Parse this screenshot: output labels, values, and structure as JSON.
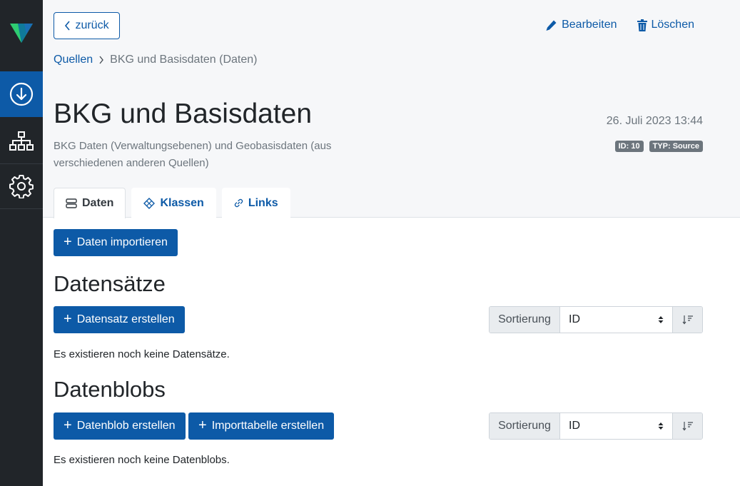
{
  "sidebar": {
    "logo": "app-logo",
    "items": [
      {
        "icon": "download-circle-icon",
        "active": true
      },
      {
        "icon": "sitemap-icon",
        "active": false
      },
      {
        "icon": "gear-icon",
        "active": false
      }
    ]
  },
  "header": {
    "back_label": "zurück",
    "edit_label": "Bearbeiten",
    "delete_label": "Löschen",
    "breadcrumb": {
      "root": "Quellen",
      "current": "BKG und Basisdaten (Daten)"
    },
    "title": "BKG und Basisdaten",
    "description": "BKG Daten (Verwaltungsebenen) und Geobasisdaten (aus verschiedenen anderen Quellen)",
    "date": "26. Juli 2023 13:44",
    "badges": {
      "id": "ID: 10",
      "type": "TYP: Source"
    },
    "tabs": [
      {
        "label": "Daten",
        "icon": "server-icon",
        "active": true
      },
      {
        "label": "Klassen",
        "icon": "diamond-icon",
        "active": false
      },
      {
        "label": "Links",
        "icon": "link-icon",
        "active": false
      }
    ]
  },
  "main": {
    "import_label": "Daten importieren",
    "datasets": {
      "title": "Datensätze",
      "create_label": "Datensatz erstellen",
      "sort_label": "Sortierung",
      "sort_value": "ID",
      "empty": "Es existieren noch keine Datensätze."
    },
    "blobs": {
      "title": "Datenblobs",
      "create_label": "Datenblob erstellen",
      "create_table_label": "Importtabelle erstellen",
      "sort_label": "Sortierung",
      "sort_value": "ID",
      "empty": "Es existieren noch keine Datenblobs."
    }
  },
  "colors": {
    "primary": "#0d5aa7",
    "sidebar": "#212529",
    "header_bg": "#f6f7f9",
    "logo_green": "#2ecc71",
    "logo_blue": "#1a6fb5"
  }
}
